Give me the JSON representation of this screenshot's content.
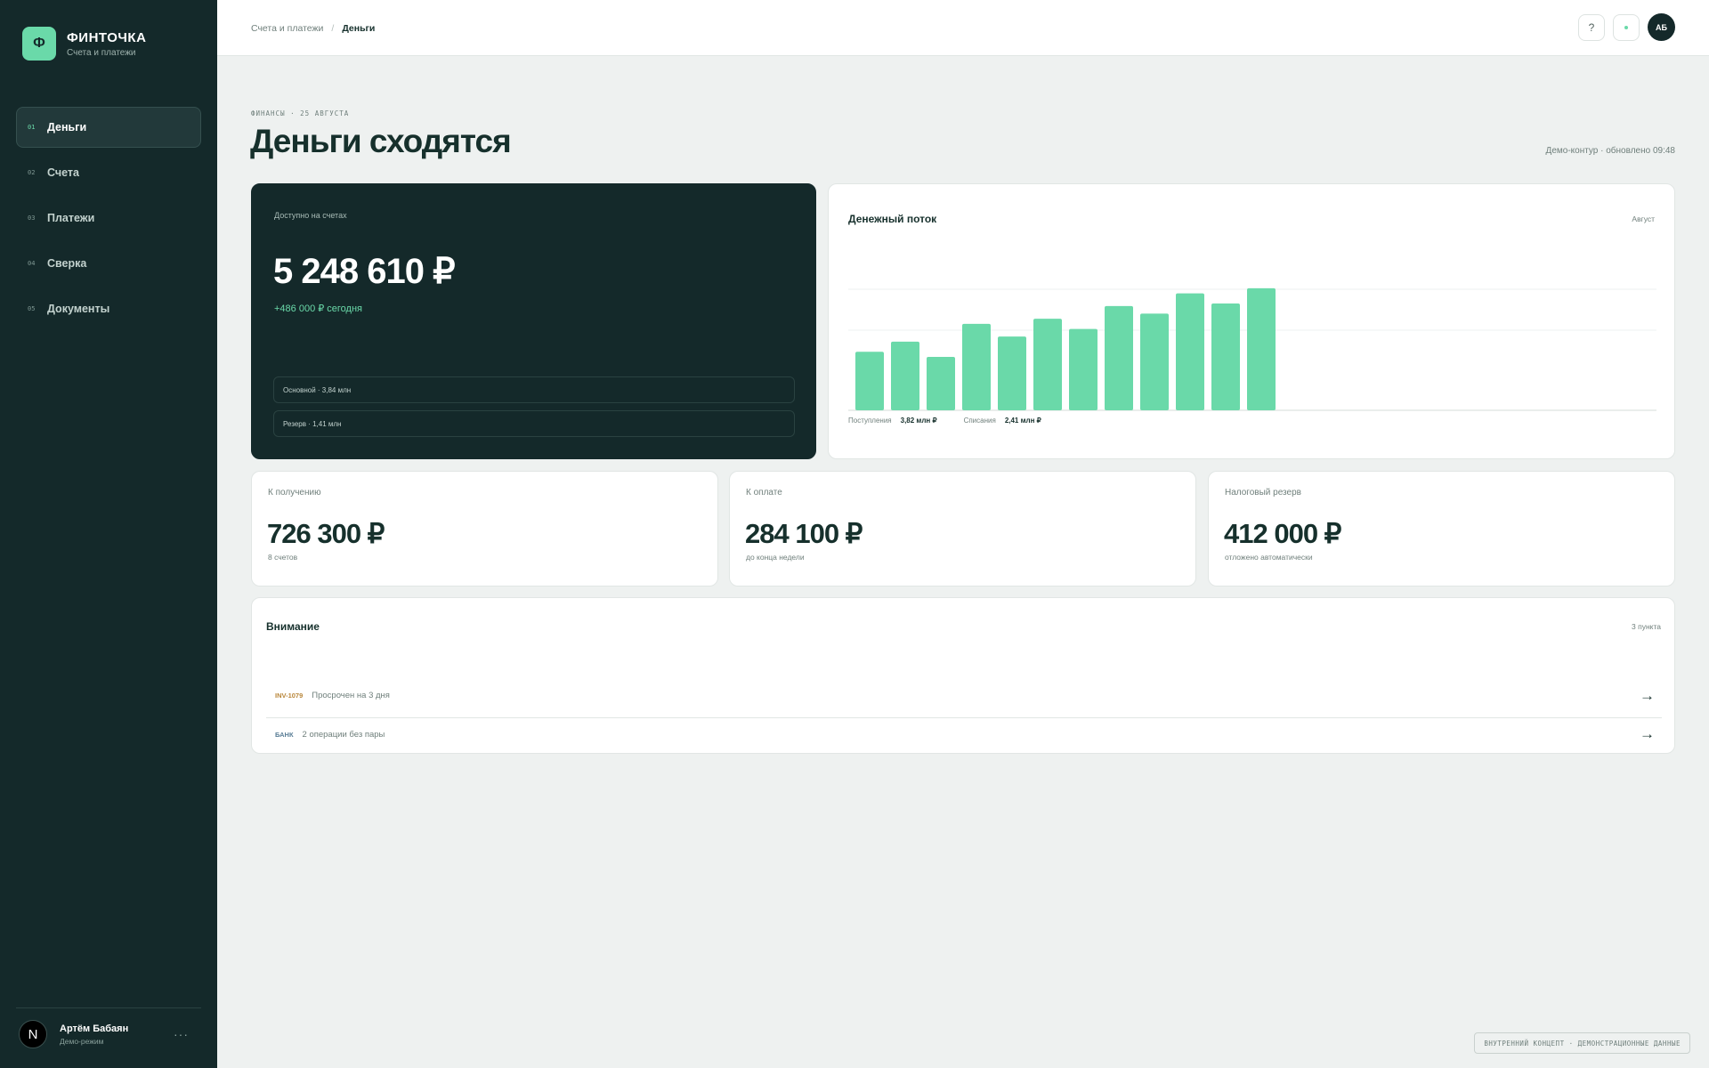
{
  "brand": {
    "logo_letter": "Ф",
    "name": "ФИНТОЧКА",
    "subtitle": "Счета и платежи"
  },
  "nav": [
    {
      "num": "01",
      "label": "Деньги",
      "active": true
    },
    {
      "num": "02",
      "label": "Счета",
      "active": false
    },
    {
      "num": "03",
      "label": "Платежи",
      "active": false
    },
    {
      "num": "04",
      "label": "Сверка",
      "active": false
    },
    {
      "num": "05",
      "label": "Документы",
      "active": false
    }
  ],
  "user": {
    "avatar_letter": "N",
    "name": "Артём Бабаян",
    "role": "Демо-режим",
    "more": "···"
  },
  "breadcrumb": {
    "parent": "Счета и платежи",
    "separator": "/",
    "current": "Деньги"
  },
  "topbar": {
    "help_label": "?",
    "avatar_initials": "АБ"
  },
  "header": {
    "eyebrow": "ФИНАНСЫ · 25 АВГУСТА",
    "title": "Деньги сходятся",
    "meta": "Демо-контур · обновлено 09:48"
  },
  "balance": {
    "label": "Доступно на счетах",
    "amount": "5 248 610 ₽",
    "delta": "+486 000 ₽ сегодня",
    "accounts": [
      "Основной · 3,84 млн",
      "Резерв · 1,41 млн"
    ]
  },
  "cashflow": {
    "title": "Денежный поток",
    "period": "Август",
    "legend": [
      {
        "label": "Поступления",
        "value": "3,82 млн ₽"
      },
      {
        "label": "Списания",
        "value": "2,41 млн ₽"
      }
    ]
  },
  "chart_data": {
    "type": "bar",
    "title": "Денежный поток",
    "values": [
      46,
      54,
      42,
      68,
      58,
      72,
      64,
      82,
      76,
      92,
      84,
      96
    ],
    "ylim": [
      0,
      112
    ],
    "bar_color": "#6ad9a9",
    "grid": true
  },
  "stats": [
    {
      "label": "К получению",
      "value": "726 300 ₽",
      "sub": "8 счетов"
    },
    {
      "label": "К оплате",
      "value": "284 100 ₽",
      "sub": "до конца недели"
    },
    {
      "label": "Налоговый резерв",
      "value": "412 000 ₽",
      "sub": "отложено автоматически"
    }
  ],
  "attention": {
    "title": "Внимание",
    "count": "3 пункта",
    "rows": [
      {
        "tag": "INV-1079",
        "text": "Просрочен на 3 дня",
        "arrow": "→"
      },
      {
        "tag": "БАНК",
        "text": "2 операции без пары",
        "arrow": "→"
      }
    ]
  },
  "footer_badge": "ВНУТРЕННИЙ КОНЦЕПТ · ДЕМОНСТРАЦИОННЫЕ ДАННЫЕ",
  "colors": {
    "sidebar": "#14292a",
    "accent": "#6ad9a9",
    "background": "#eef1f0"
  }
}
